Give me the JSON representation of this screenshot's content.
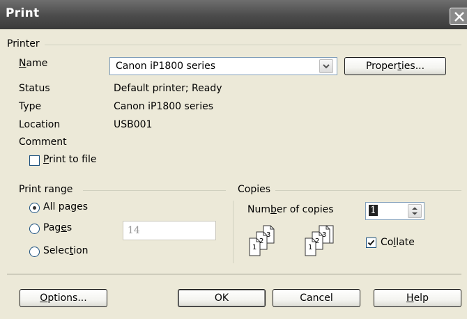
{
  "window": {
    "title": "Print"
  },
  "printer": {
    "group_label": "Printer",
    "name_label_pre": "",
    "name_label_u": "N",
    "name_label_post": "ame",
    "selected_printer": "Canon iP1800 series",
    "properties_pre": "Proper",
    "properties_u": "t",
    "properties_post": "ies...",
    "status_label": "Status",
    "status_value": "Default printer; Ready",
    "type_label": "Type",
    "type_value": "Canon iP1800 series",
    "location_label": "Location",
    "location_value": "USB001",
    "comment_label": "Comment",
    "comment_value": "",
    "print_to_file_u": "P",
    "print_to_file_post": "rint to file",
    "print_to_file_checked": false
  },
  "print_range": {
    "group_label": "Print range",
    "all_pages_pre": "All pa",
    "all_pages_u": "g",
    "all_pages_post": "es",
    "pages_pre": "Pag",
    "pages_u": "e",
    "pages_post": "s",
    "pages_value": "14",
    "selection_pre": "Selec",
    "selection_u": "t",
    "selection_post": "ion",
    "selected": "All pages"
  },
  "copies": {
    "group_label": "Copies",
    "number_label_pre": "Num",
    "number_label_u": "b",
    "number_label_post": "er of copies",
    "number_value": "1",
    "collate_pre": "Co",
    "collate_u": "l",
    "collate_post": "late",
    "collate_checked": true,
    "page_numbers": [
      "1",
      "2",
      "3"
    ]
  },
  "buttons": {
    "options_pre": "",
    "options_u": "O",
    "options_post": "ptions...",
    "ok": "OK",
    "cancel": "Cancel",
    "help_pre": "",
    "help_u": "H",
    "help_post": "elp"
  }
}
